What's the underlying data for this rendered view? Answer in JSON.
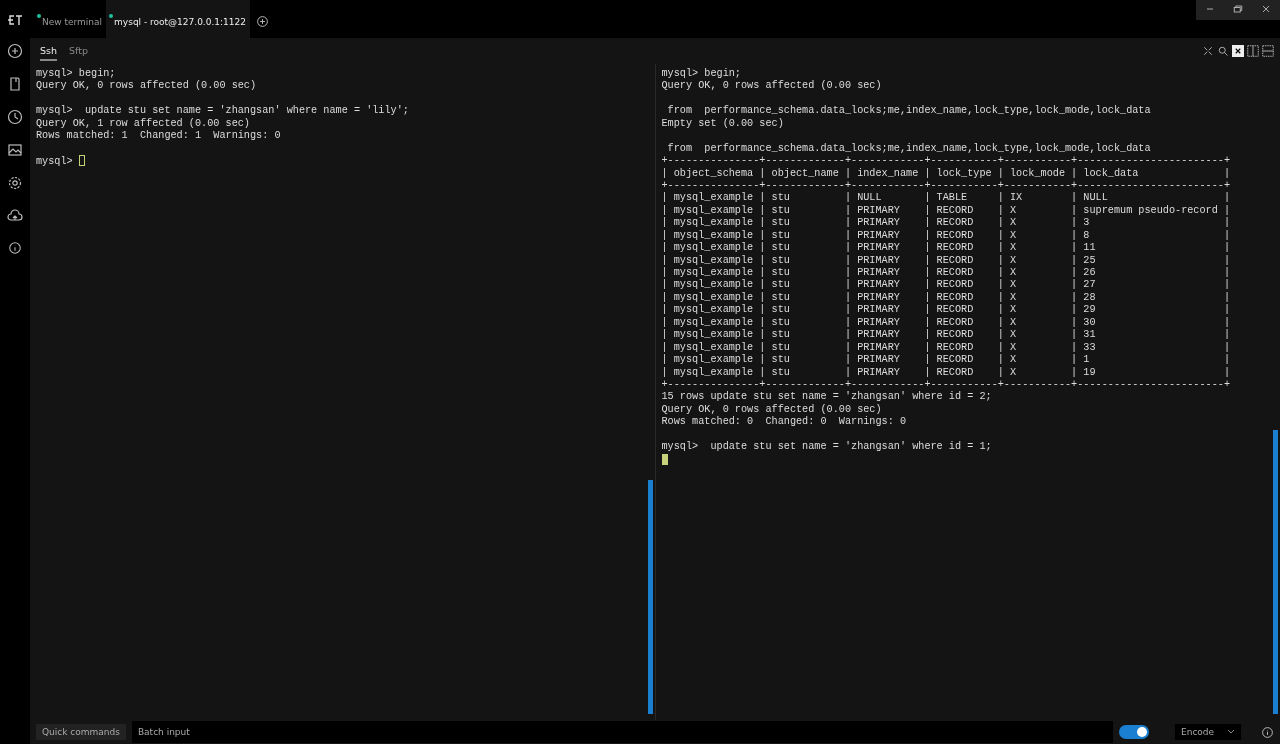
{
  "tabs": [
    {
      "label": "New terminal",
      "selected": false,
      "online": true
    },
    {
      "label": "mysql - root@127.0.0.1:1122",
      "selected": true,
      "online": true
    }
  ],
  "subtabs": [
    {
      "label": "Ssh",
      "selected": true
    },
    {
      "label": "Sftp",
      "selected": false
    }
  ],
  "panes": [
    {
      "blocks": [
        {
          "lines": [
            {
              "text": "mysql> begin;"
            },
            {
              "text": "Query OK, 0 rows affected (0.00 sec)"
            }
          ]
        },
        {
          "lines": [
            {
              "text": "mysql>  update stu set name = 'zhangsan' where name = 'lily';"
            },
            {
              "text": "Query OK, 1 row affected (0.00 sec)"
            },
            {
              "text": "Rows matched: 1  Changed: 1  Warnings: 0"
            }
          ]
        },
        {
          "lines": [
            {
              "text": "mysql> ",
              "cursor": {
                "filled": false
              }
            }
          ]
        }
      ]
    },
    {
      "blocks": [
        {
          "lines": [
            {
              "text": "mysql> begin;"
            },
            {
              "text": "Query OK, 0 rows affected (0.00 sec)"
            }
          ]
        },
        {
          "lines": [
            {
              "text": " from  performance_schema.data_locks;me,index_name,lock_type,lock_mode,lock_data"
            },
            {
              "text": "Empty set (0.00 sec)"
            }
          ]
        },
        {
          "lines": [
            {
              "text": " from  performance_schema.data_locks;me,index_name,lock_type,lock_mode,lock_data"
            },
            {
              "text": "+---------------+-------------+------------+-----------+-----------+------------------------+"
            },
            {
              "text": "| object_schema | object_name | index_name | lock_type | lock_mode | lock_data              |"
            },
            {
              "text": "+---------------+-------------+------------+-----------+-----------+------------------------+"
            },
            {
              "text": "| mysql_example | stu         | NULL       | TABLE     | IX        | NULL                   |"
            },
            {
              "text": "| mysql_example | stu         | PRIMARY    | RECORD    | X         | supremum pseudo-record |"
            },
            {
              "text": "| mysql_example | stu         | PRIMARY    | RECORD    | X         | 3                      |"
            },
            {
              "text": "| mysql_example | stu         | PRIMARY    | RECORD    | X         | 8                      |"
            },
            {
              "text": "| mysql_example | stu         | PRIMARY    | RECORD    | X         | 11                     |"
            },
            {
              "text": "| mysql_example | stu         | PRIMARY    | RECORD    | X         | 25                     |"
            },
            {
              "text": "| mysql_example | stu         | PRIMARY    | RECORD    | X         | 26                     |"
            },
            {
              "text": "| mysql_example | stu         | PRIMARY    | RECORD    | X         | 27                     |"
            },
            {
              "text": "| mysql_example | stu         | PRIMARY    | RECORD    | X         | 28                     |"
            },
            {
              "text": "| mysql_example | stu         | PRIMARY    | RECORD    | X         | 29                     |"
            },
            {
              "text": "| mysql_example | stu         | PRIMARY    | RECORD    | X         | 30                     |"
            },
            {
              "text": "| mysql_example | stu         | PRIMARY    | RECORD    | X         | 31                     |"
            },
            {
              "text": "| mysql_example | stu         | PRIMARY    | RECORD    | X         | 33                     |"
            },
            {
              "text": "| mysql_example | stu         | PRIMARY    | RECORD    | X         | 1                      |"
            },
            {
              "text": "| mysql_example | stu         | PRIMARY    | RECORD    | X         | 19                     |"
            },
            {
              "text": "+---------------+-------------+------------+-----------+-----------+------------------------+"
            },
            {
              "text": "15 rows update stu set name = 'zhangsan' where id = 2;"
            },
            {
              "text": "Query OK, 0 rows affected (0.00 sec)"
            },
            {
              "text": "Rows matched: 0  Changed: 0  Warnings: 0"
            }
          ]
        },
        {
          "lines": [
            {
              "text": "mysql>  update stu set name = 'zhangsan' where id = 1;"
            },
            {
              "cursor": {
                "filled": true
              }
            }
          ]
        }
      ]
    }
  ],
  "footer": {
    "quick_commands": "Quick commands",
    "batch_input": {
      "placeholder": "Batch input"
    },
    "toggle": {
      "on": true
    },
    "encode": "Encode"
  }
}
